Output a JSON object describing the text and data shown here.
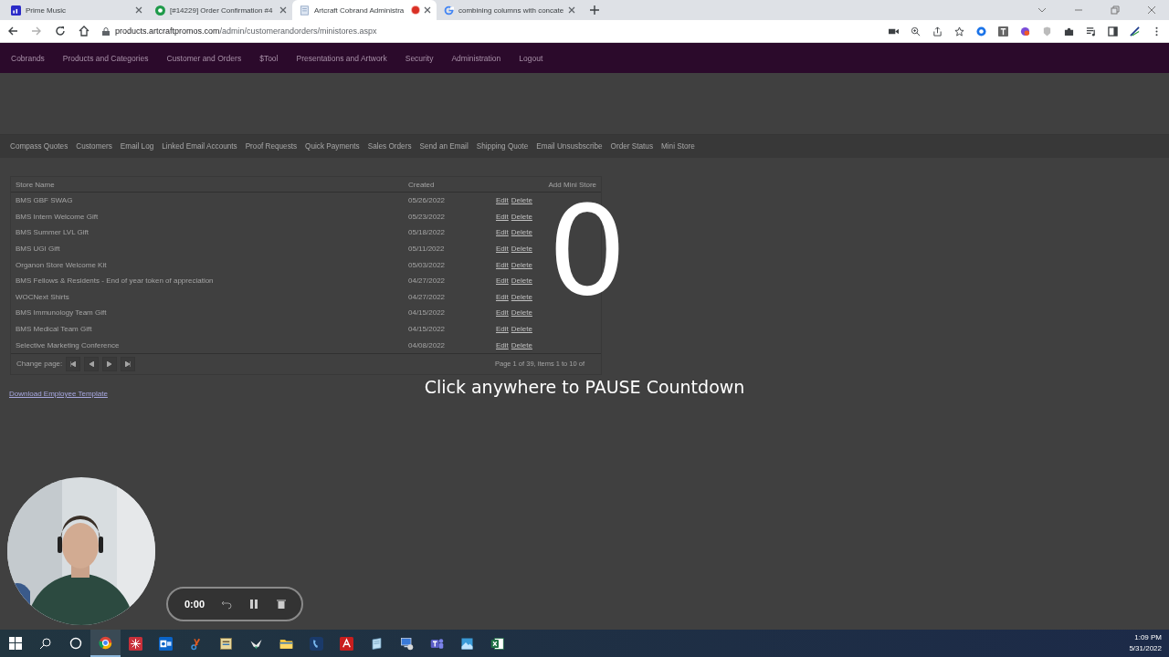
{
  "browser": {
    "tabs": [
      {
        "title": "Prime Music",
        "selected": false,
        "recording": false
      },
      {
        "title": "[#14229] Order Confirmation #4",
        "selected": false,
        "recording": false
      },
      {
        "title": "Artcraft Cobrand Administra",
        "selected": true,
        "recording": true
      },
      {
        "title": "combining columns with concate",
        "selected": false,
        "recording": false
      }
    ],
    "url_host": "products.artcraftpromos.com",
    "url_path": "/admin/customerandorders/ministores.aspx"
  },
  "page": {
    "nav": [
      "Cobrands",
      "Products and Categories",
      "Customer and Orders",
      "$Tool",
      "Presentations and Artwork",
      "Security",
      "Administration",
      "Logout"
    ],
    "subnav": [
      "Compass Quotes",
      "Customers",
      "Email Log",
      "Linked Email Accounts",
      "Proof Requests",
      "Quick Payments",
      "Sales Orders",
      "Send an Email",
      "Shipping Quote",
      "Email Unsusbscribe",
      "Order Status",
      "Mini Store"
    ],
    "table": {
      "columns": [
        "Store Name",
        "Created"
      ],
      "add_link": "Add Mini Store",
      "rows": [
        {
          "store_name": "BMS GBF SWAG",
          "created": "05/26/2022",
          "edit": "Edit",
          "delete": "Delete"
        },
        {
          "store_name": "BMS Intern Welcome Gift",
          "created": "05/23/2022",
          "edit": "Edit",
          "delete": "Delete"
        },
        {
          "store_name": "BMS Summer LVL Gift",
          "created": "05/18/2022",
          "edit": "Edit",
          "delete": "Delete"
        },
        {
          "store_name": "BMS UGI Gift",
          "created": "05/11/2022",
          "edit": "Edit",
          "delete": "Delete"
        },
        {
          "store_name": "Organon Store Welcome Kit",
          "created": "05/03/2022",
          "edit": "Edit",
          "delete": "Delete"
        },
        {
          "store_name": "BMS Fellows & Residents - End of year token of appreciation",
          "created": "04/27/2022",
          "edit": "Edit",
          "delete": "Delete"
        },
        {
          "store_name": "WOCNext Shirts",
          "created": "04/27/2022",
          "edit": "Edit",
          "delete": "Delete"
        },
        {
          "store_name": "BMS Immunology Team Gift",
          "created": "04/15/2022",
          "edit": "Edit",
          "delete": "Delete"
        },
        {
          "store_name": "BMS Medical Team Gift",
          "created": "04/15/2022",
          "edit": "Edit",
          "delete": "Delete"
        },
        {
          "store_name": "Selective Marketing Conference",
          "created": "04/08/2022",
          "edit": "Edit",
          "delete": "Delete"
        }
      ],
      "pager_label": "Change page:",
      "pager_info": "Page 1 of 39, items 1 to 10 of"
    },
    "download_link": "Download Employee Template"
  },
  "countdown": {
    "digit": "0",
    "message": "Click anywhere to PAUSE Countdown"
  },
  "recorder": {
    "time": "0:00"
  },
  "taskbar": {
    "apps": [
      {
        "kind": "chrome",
        "selected": true
      },
      {
        "kind": "star",
        "selected": false
      },
      {
        "kind": "outlook",
        "selected": false
      },
      {
        "kind": "tool",
        "selected": false
      },
      {
        "kind": "note",
        "selected": false
      },
      {
        "kind": "bird",
        "selected": false
      },
      {
        "kind": "folder",
        "selected": false
      },
      {
        "kind": "phone",
        "selected": false
      },
      {
        "kind": "pdf",
        "selected": false
      },
      {
        "kind": "notepad",
        "selected": false
      },
      {
        "kind": "network",
        "selected": false
      },
      {
        "kind": "teams",
        "selected": false
      },
      {
        "kind": "photos",
        "selected": false
      },
      {
        "kind": "excel",
        "selected": false
      }
    ],
    "time": "1:09 PM",
    "date": "5/31/2022"
  }
}
